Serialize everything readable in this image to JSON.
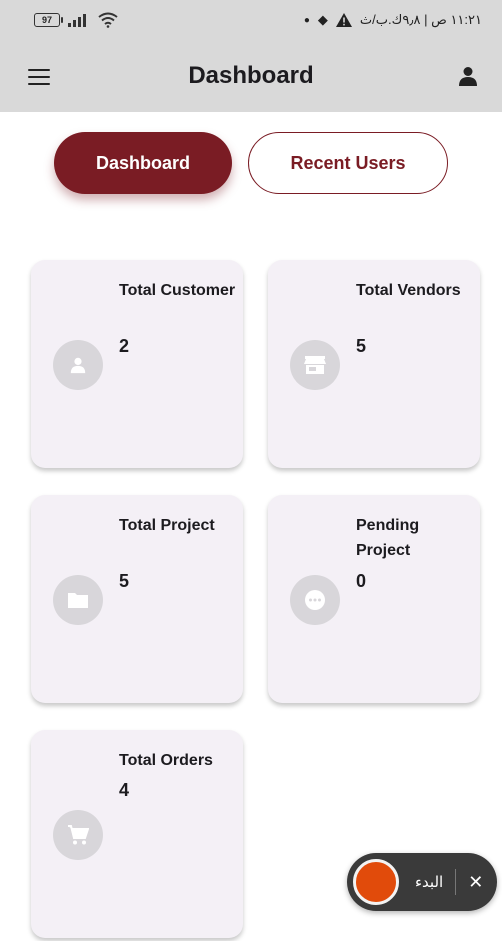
{
  "status_bar": {
    "battery": "97",
    "time_text": "١١:٢١ ص | ٩٫٨ك.ب/ث",
    "signal_icon": "signal-icon",
    "wifi_icon": "wifi-icon"
  },
  "app_bar": {
    "title": "Dashboard"
  },
  "tabs": [
    {
      "label": "Dashboard",
      "active": true
    },
    {
      "label": "Recent Users",
      "active": false
    }
  ],
  "cards": [
    {
      "title": "Total Customer",
      "value": "2",
      "icon": "person-icon"
    },
    {
      "title": "Total Vendors",
      "value": "5",
      "icon": "store-icon"
    },
    {
      "title": "Total Project",
      "value": "5",
      "icon": "folder-icon"
    },
    {
      "title": "Pending Project",
      "value": "0",
      "icon": "pending-icon"
    },
    {
      "title": "Total Orders",
      "value": "4",
      "icon": "cart-icon"
    }
  ],
  "recorder": {
    "label": "البدء",
    "close": "✕"
  },
  "colors": {
    "accent": "#7a1c24",
    "app_bar_bg": "#d9d9d9",
    "card_bg": "#f4f0f6",
    "record": "#e14b0b"
  }
}
